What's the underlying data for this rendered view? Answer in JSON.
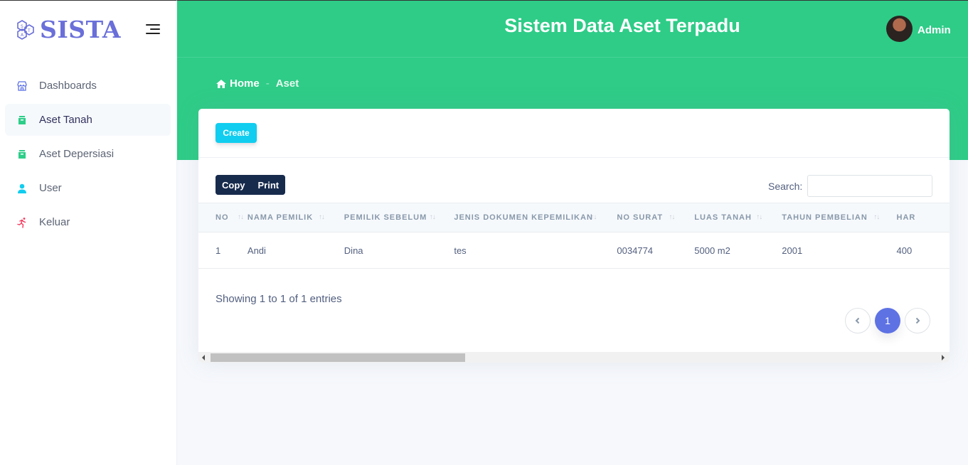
{
  "brand": {
    "name": "SISTA"
  },
  "sidebar": {
    "items": [
      {
        "label": "Dashboards",
        "icon": "shop-icon",
        "active": false
      },
      {
        "label": "Aset Tanah",
        "icon": "archive-icon",
        "active": true
      },
      {
        "label": "Aset Depersiasi",
        "icon": "archive-icon",
        "active": false
      },
      {
        "label": "User",
        "icon": "user-icon",
        "active": false
      },
      {
        "label": "Keluar",
        "icon": "run-icon",
        "active": false
      }
    ]
  },
  "header": {
    "title": "Sistem Data Aset Terpadu",
    "user_name": "Admin"
  },
  "breadcrumb": {
    "home": "Home",
    "current": "Aset"
  },
  "card": {
    "create_label": "Create",
    "copy_label": "Copy",
    "print_label": "Print",
    "search_label": "Search:",
    "search_value": ""
  },
  "table": {
    "columns": [
      "No",
      "Nama Pemilik",
      "Pemilik Sebelum",
      "Jenis Dokumen Kepemilikan",
      "No Surat",
      "Luas Tanah",
      "Tahun Pembelian",
      "Har"
    ],
    "rows": [
      [
        "1",
        "Andi",
        "Dina",
        "tes",
        "0034774",
        "5000 m2",
        "2001",
        "400"
      ]
    ]
  },
  "footer": {
    "info": "Showing 1 to 1 of 1 entries",
    "current_page": "1"
  },
  "colors": {
    "header_green": "#2ecc87",
    "brand": "#6a6fd9",
    "create_button": "#11cdef",
    "dark_button": "#172b4d",
    "page_active": "#5e72e4"
  }
}
